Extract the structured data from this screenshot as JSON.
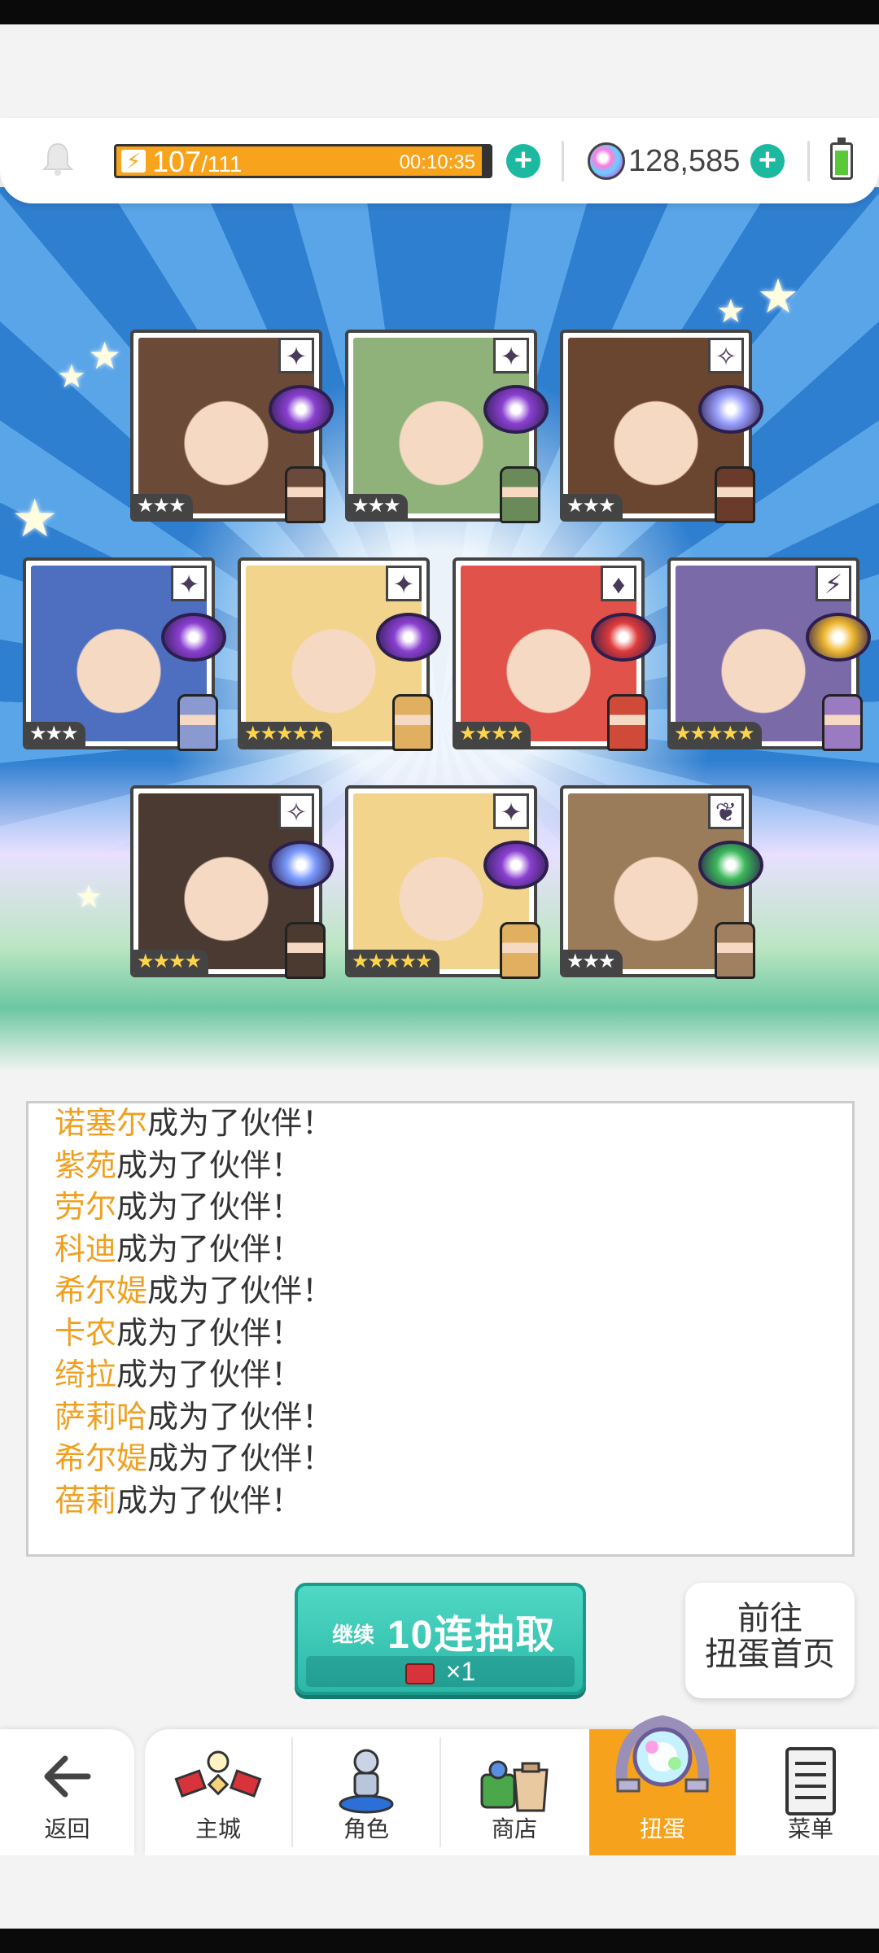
{
  "header": {
    "stamina_current": "107",
    "stamina_max": "/111",
    "stamina_timer": "00:10:35",
    "gems": "128,585"
  },
  "cards": [
    {
      "stars": "★★★",
      "element": "✦",
      "bg": "#6b4a38"
    },
    {
      "stars": "★★★",
      "element": "✦",
      "bg": "#8fb27a"
    },
    {
      "stars": "★★★",
      "element": "✧",
      "bg": "#6a4530"
    },
    {
      "stars": "★★★",
      "element": "✦",
      "bg": "#4e6fc0"
    },
    {
      "stars": "★★★★★",
      "element": "✦",
      "bg": "#f2d48c"
    },
    {
      "stars": "★★★★",
      "element": "♦",
      "bg": "#e0524a"
    },
    {
      "stars": "★★★★★",
      "element": "⚡",
      "bg": "#7b6aa8"
    },
    {
      "stars": "★★★★",
      "element": "✧",
      "bg": "#4a3a32"
    },
    {
      "stars": "★★★★★",
      "element": "✦",
      "bg": "#f2d48c"
    },
    {
      "stars": "★★★",
      "element": "❦",
      "bg": "#9b7c5a"
    }
  ],
  "log": {
    "suffix": "成为了伙伴！",
    "suffix_cut": "成为了伙伴！",
    "names": [
      "诺塞尔",
      "紫苑",
      "劳尔",
      "科迪",
      "希尔媞",
      "卡农",
      "绮拉",
      "萨莉哈",
      "希尔媞",
      "蓓莉"
    ]
  },
  "actions": {
    "continue_label": "继续",
    "draw_label": "10连抽取",
    "cost": "×1",
    "goto_line1": "前往",
    "goto_line2": "扭蛋首页"
  },
  "nav": {
    "back": "返回",
    "town": "主城",
    "character": "角色",
    "shop": "商店",
    "gacha": "扭蛋",
    "menu": "菜单"
  },
  "colors": {
    "accent_orange": "#f7a21d",
    "teal": "#2cb7a8",
    "name_orange": "#f0a020"
  }
}
